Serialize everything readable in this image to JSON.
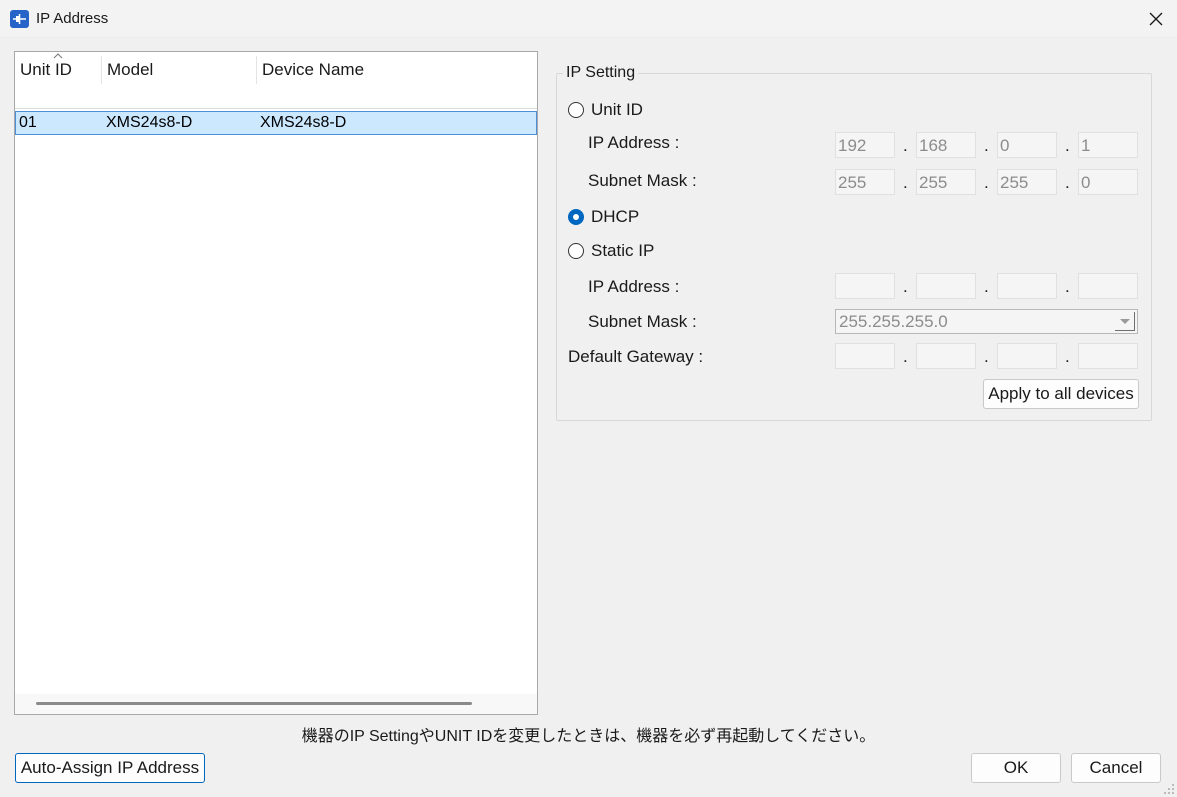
{
  "window": {
    "title": "IP Address",
    "close_label": "✕"
  },
  "device_list": {
    "columns": [
      "Unit ID",
      "Model",
      "Device Name"
    ],
    "rows": [
      {
        "unit_id": "01",
        "model": "XMS24s8-D",
        "device_name": "XMS24s8-D",
        "selected": true
      }
    ]
  },
  "ip_setting": {
    "group_title": "IP Setting",
    "mode_selected": "DHCP",
    "unit_id_option": {
      "label": "Unit ID",
      "ip_address_label": "IP Address :",
      "ip_address": [
        "192",
        "168",
        "0",
        "1"
      ],
      "subnet_mask_label": "Subnet Mask :",
      "subnet_mask": [
        "255",
        "255",
        "255",
        "0"
      ]
    },
    "dhcp_option": {
      "label": "DHCP"
    },
    "static_ip_option": {
      "label": "Static IP",
      "ip_address_label": "IP Address :",
      "ip_address": [
        "",
        "",
        "",
        ""
      ],
      "subnet_mask_label": "Subnet Mask :",
      "subnet_mask_value": "255.255.255.0",
      "default_gateway_label": "Default Gateway :",
      "default_gateway": [
        "",
        "",
        "",
        ""
      ]
    },
    "octet_separator": ".",
    "apply_all_label": "Apply to all devices"
  },
  "footer": {
    "note": "機器のIP SettingやUNIT IDを変更したときは、機器を必ず再起動してください。",
    "auto_assign_label": "Auto-Assign IP Address",
    "ok_label": "OK",
    "cancel_label": "Cancel"
  },
  "colors": {
    "selection_bg": "#cce8ff",
    "selection_border": "#4a90d6",
    "radio_accent": "#0067c0",
    "disabled_text": "#8c8c8c"
  }
}
